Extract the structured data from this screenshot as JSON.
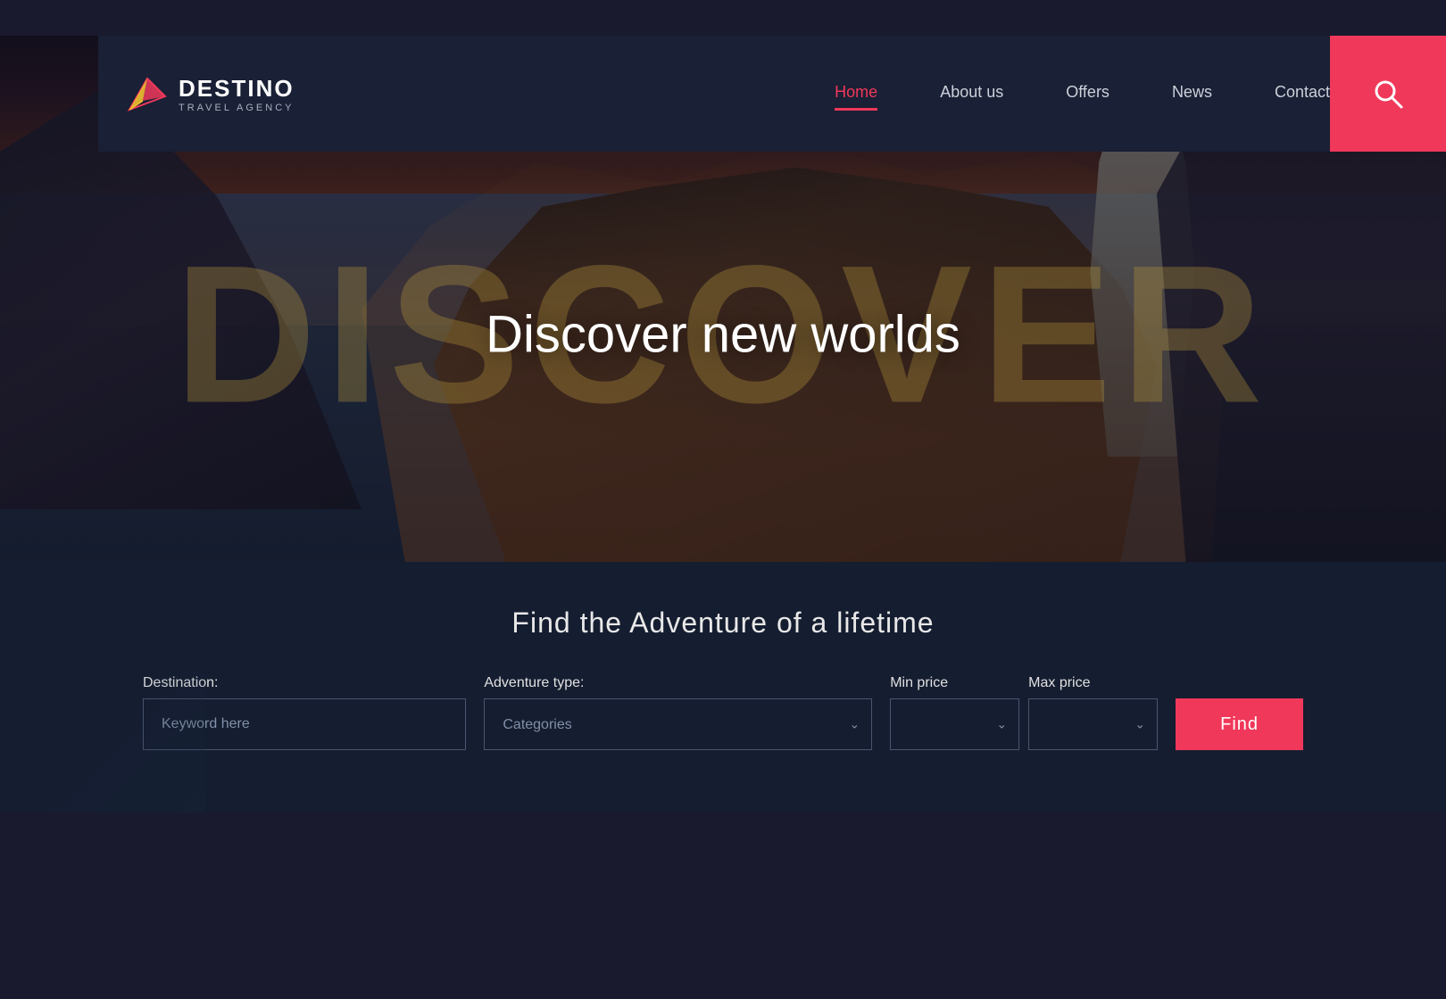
{
  "brand": {
    "name": "DESTINO",
    "tagline": "TRAVEL AGENCY",
    "logo_icon": "plane-icon"
  },
  "nav": {
    "items": [
      {
        "label": "Home",
        "active": true
      },
      {
        "label": "About us",
        "active": false
      },
      {
        "label": "Offers",
        "active": false
      },
      {
        "label": "News",
        "active": false
      },
      {
        "label": "Contact",
        "active": false
      }
    ]
  },
  "hero": {
    "bg_text": "DISCOVER",
    "headline": "Discover new worlds"
  },
  "search": {
    "section_title": "Find the Adventure of a lifetime",
    "destination_label": "Destination:",
    "destination_placeholder": "Keyword here",
    "adventure_label": "Adventure type:",
    "adventure_placeholder": "Categories",
    "min_price_label": "Min price",
    "max_price_label": "Max price",
    "find_button": "Find"
  }
}
